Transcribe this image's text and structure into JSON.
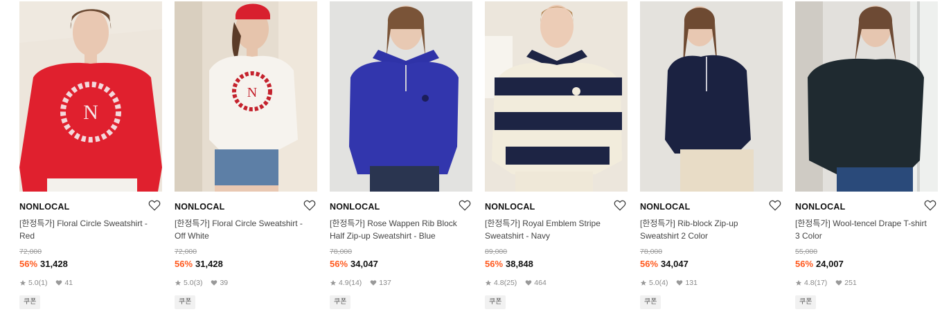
{
  "products": [
    {
      "brand": "NONLOCAL",
      "name_tag": "[한정특가]",
      "name_line1": "Floral Circle Sweatshirt -",
      "name_line2": "Red",
      "original_price": "72,000",
      "discount": "56%",
      "price": "31,428",
      "rating": "5.0",
      "reviews": "(1)",
      "likes": "41",
      "coupon": "쿠폰"
    },
    {
      "brand": "NONLOCAL",
      "name_tag": "[한정특가]",
      "name_line1": "Floral Circle Sweatshirt -",
      "name_line2": "Off White",
      "original_price": "72,000",
      "discount": "56%",
      "price": "31,428",
      "rating": "5.0",
      "reviews": "(3)",
      "likes": "39",
      "coupon": "쿠폰"
    },
    {
      "brand": "NONLOCAL",
      "name_tag": "[한정특가]",
      "name_line1": "Rose Wappen Rib Block",
      "name_line2": "Half Zip-up Sweatshirt - Blue",
      "original_price": "78,000",
      "discount": "56%",
      "price": "34,047",
      "rating": "4.9",
      "reviews": "(14)",
      "likes": "137",
      "coupon": "쿠폰"
    },
    {
      "brand": "NONLOCAL",
      "name_tag": "[한정특가]",
      "name_line1": "Royal Emblem Stripe",
      "name_line2": "Sweatshirt - Navy",
      "original_price": "89,000",
      "discount": "56%",
      "price": "38,848",
      "rating": "4.8",
      "reviews": "(25)",
      "likes": "464",
      "coupon": "쿠폰"
    },
    {
      "brand": "NONLOCAL",
      "name_tag": "[한정특가]",
      "name_line1": "Rib-block Zip-up",
      "name_line2": "Sweatshirt 2 Color",
      "original_price": "78,000",
      "discount": "56%",
      "price": "34,047",
      "rating": "5.0",
      "reviews": "(4)",
      "likes": "131",
      "coupon": "쿠폰"
    },
    {
      "brand": "NONLOCAL",
      "name_tag": "[한정특가]",
      "name_line1": "Wool-tencel Drape T-shirt",
      "name_line2": "3 Color",
      "original_price": "55,000",
      "discount": "56%",
      "price": "24,007",
      "rating": "4.8",
      "reviews": "(17)",
      "likes": "251",
      "coupon": "쿠폰"
    }
  ],
  "colors": {
    "discount": "#ff5a1f",
    "text": "#222222",
    "muted": "#999999",
    "coupon_bg": "#f1f1f1"
  },
  "icons": {
    "wishlist": "heart-outline-icon",
    "rating": "star-icon",
    "likes": "heart-filled-icon"
  }
}
